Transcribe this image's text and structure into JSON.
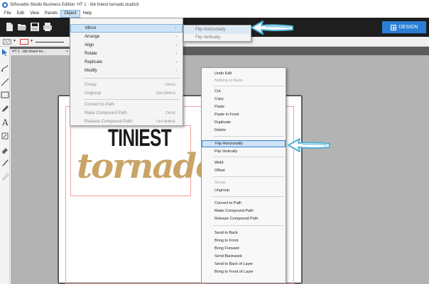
{
  "window": {
    "title": "Silhouette Studio Business Edition: HT 1 - bib tiniest tornado.studio3"
  },
  "menubar": {
    "items": [
      "File",
      "Edit",
      "View",
      "Panels",
      "Object",
      "Help"
    ],
    "active": "Object"
  },
  "toolbar": {
    "design_label": "DESIGN"
  },
  "doc_tab": {
    "label": "HT 1 - bib tiniest tor...",
    "close": "×"
  },
  "canvas": {
    "design_text_top": "TINIEST",
    "design_text_bottom": "tornado",
    "design_color_top": "#1c1c1c",
    "design_color_bottom": "#c9a466"
  },
  "object_menu": {
    "items": [
      {
        "label": "Mirror",
        "arrow": "›",
        "shortcut": "",
        "disabled": false,
        "highlighted": true
      },
      {
        "label": "Arrange",
        "arrow": "›",
        "shortcut": "",
        "disabled": false
      },
      {
        "label": "Align",
        "arrow": "›",
        "shortcut": "",
        "disabled": false
      },
      {
        "label": "Rotate",
        "arrow": "›",
        "shortcut": "",
        "disabled": false
      },
      {
        "label": "Replicate",
        "arrow": "›",
        "shortcut": "",
        "disabled": false
      },
      {
        "label": "Modify",
        "arrow": "›",
        "shortcut": "",
        "disabled": false
      },
      {
        "label": "Group",
        "arrow": "",
        "shortcut": "Ctrl+G",
        "disabled": true
      },
      {
        "label": "Ungroup",
        "arrow": "",
        "shortcut": "Ctrl+Shift+G",
        "disabled": true
      },
      {
        "label": "Convert to Path",
        "arrow": "",
        "shortcut": "",
        "disabled": true
      },
      {
        "label": "Make Compound Path",
        "arrow": "",
        "shortcut": "Ctrl+E",
        "disabled": true
      },
      {
        "label": "Release Compound Path",
        "arrow": "",
        "shortcut": "Ctrl+Shift+E",
        "disabled": true
      }
    ]
  },
  "mirror_submenu": {
    "items": [
      "Flip Horizontally",
      "Flip Vertically"
    ]
  },
  "context_menu": {
    "items": [
      {
        "label": "Undo Edit",
        "disabled": false
      },
      {
        "label": "Nothing to Redo",
        "disabled": true
      },
      {
        "label": "Cut",
        "disabled": false
      },
      {
        "label": "Copy",
        "disabled": false
      },
      {
        "label": "Paste",
        "disabled": false
      },
      {
        "label": "Paste in Front",
        "disabled": false
      },
      {
        "label": "Duplicate",
        "disabled": false
      },
      {
        "label": "Delete",
        "disabled": false
      },
      {
        "label": "Flip Horizontally",
        "disabled": false,
        "highlighted": true
      },
      {
        "label": "Flip Vertically",
        "disabled": false
      },
      {
        "label": "Weld",
        "disabled": false
      },
      {
        "label": "Offset",
        "disabled": false
      },
      {
        "label": "Group",
        "disabled": true
      },
      {
        "label": "Ungroup",
        "disabled": false
      },
      {
        "label": "Convert to Path",
        "disabled": false
      },
      {
        "label": "Make Compound Path",
        "disabled": false
      },
      {
        "label": "Release Compound Path",
        "disabled": false
      },
      {
        "label": "Send to Back",
        "disabled": false
      },
      {
        "label": "Bring to Front",
        "disabled": false
      },
      {
        "label": "Bring Forward",
        "disabled": false
      },
      {
        "label": "Send Backward",
        "disabled": false
      },
      {
        "label": "Send to Back of Layer",
        "disabled": false
      },
      {
        "label": "Bring to Front of Layer",
        "disabled": false
      }
    ]
  },
  "colors": {
    "toolbar_bg": "#1e1e1e",
    "design_button": "#2a7fd4",
    "canvas_bg": "#b3b3b3",
    "highlight": "#cde3f7",
    "annotation_arrow": "#4fb3d6"
  },
  "icons": {
    "toolbar": [
      "new-document-icon",
      "open-folder-icon",
      "save-icon",
      "print-icon"
    ],
    "tools": [
      "select-arrow-icon",
      "edit-points-icon",
      "line-tool-icon",
      "rectangle-tool-icon",
      "pencil-tool-icon",
      "text-tool-icon",
      "eraser-sketch-icon",
      "eraser-icon",
      "knife-icon",
      "eyedropper-icon"
    ]
  }
}
